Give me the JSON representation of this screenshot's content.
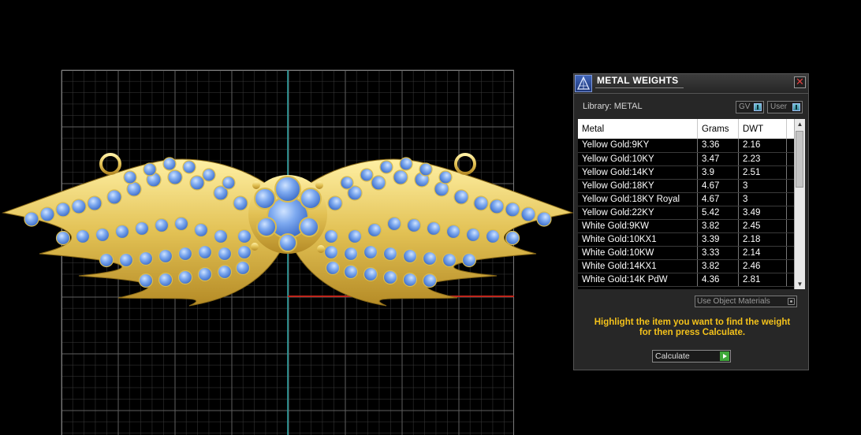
{
  "panel": {
    "title": "METAL WEIGHTS",
    "close_icon": "close-icon",
    "library_label": "Library: METAL",
    "gv_label": "GV",
    "user_label": "User",
    "columns": [
      "Metal",
      "Grams",
      "DWT"
    ],
    "rows": [
      [
        "Yellow Gold:9KY",
        "3.36",
        "2.16"
      ],
      [
        "Yellow Gold:10KY",
        "3.47",
        "2.23"
      ],
      [
        "Yellow Gold:14KY",
        "3.9",
        "2.51"
      ],
      [
        "Yellow Gold:18KY",
        "4.67",
        "3"
      ],
      [
        "Yellow Gold:18KY Royal",
        "4.67",
        "3"
      ],
      [
        "Yellow Gold:22KY",
        "5.42",
        "3.49"
      ],
      [
        "White Gold:9KW",
        "3.82",
        "2.45"
      ],
      [
        "White Gold:10KX1",
        "3.39",
        "2.18"
      ],
      [
        "White Gold:10KW",
        "3.33",
        "2.14"
      ],
      [
        "White Gold:14KX1",
        "3.82",
        "2.46"
      ],
      [
        "White Gold:14K PdW",
        "4.36",
        "2.81"
      ]
    ],
    "use_object_materials": "Use Object Materials",
    "instructions_line1": "Highlight the item you want to find the weight",
    "instructions_line2": "for then press Calculate.",
    "calculate_label": "Calculate"
  },
  "colors": {
    "accent_text": "#f4c21b",
    "gold": "#e2c154",
    "gem": "#6fa0ec",
    "grid": "#5a5a5a",
    "axis_x": "#c0261c",
    "axis_y": "#2aa7a8"
  }
}
